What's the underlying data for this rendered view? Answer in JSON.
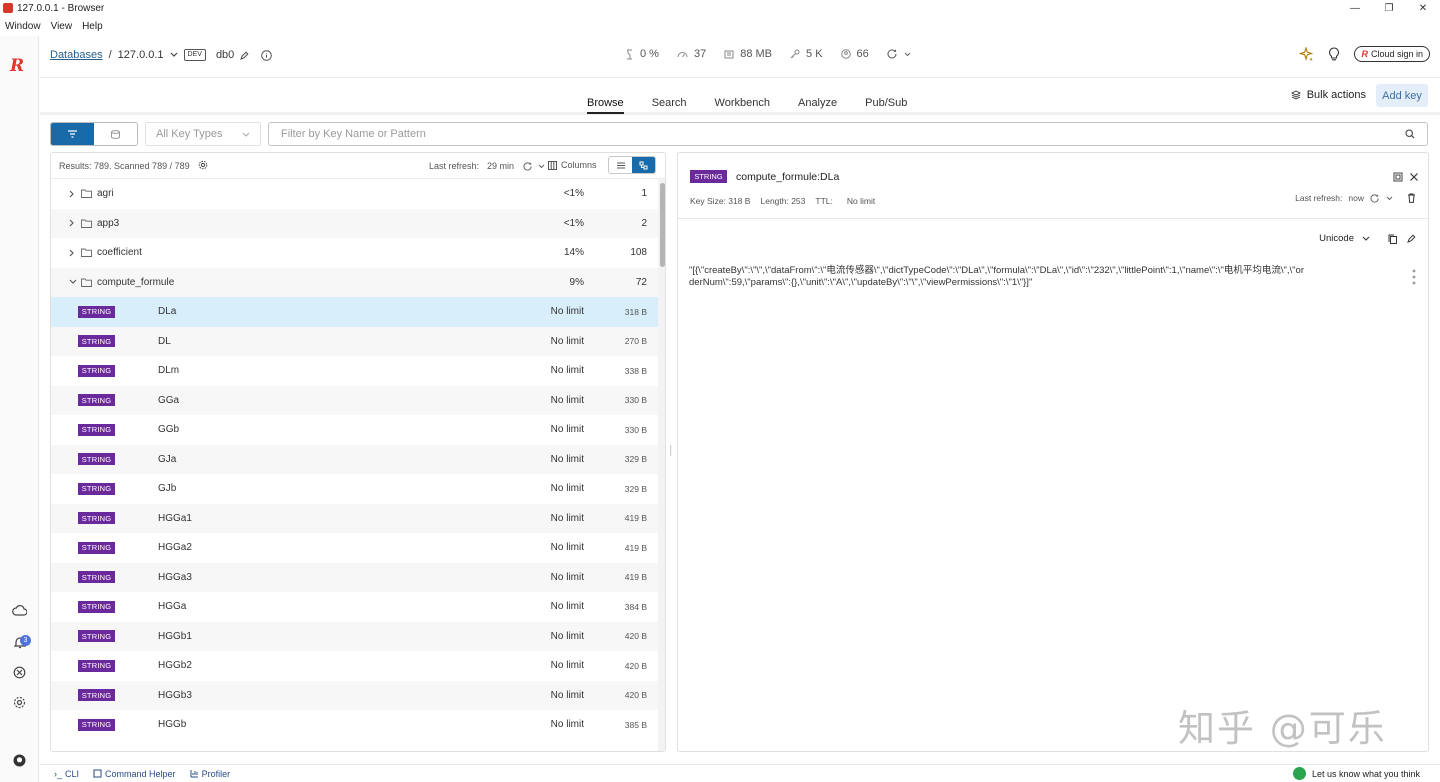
{
  "window": {
    "title": "127.0.0.1 - Browser",
    "menu": [
      "Window",
      "View",
      "Help"
    ]
  },
  "breadcrumb": {
    "databases": "Databases",
    "sep": "/",
    "host": "127.0.0.1",
    "env_badge": "DEV",
    "db": "db0"
  },
  "stats": {
    "cpu": "0 %",
    "ops": "37",
    "memory": "88 MB",
    "keys": "5 K",
    "clients": "66"
  },
  "header_right": {
    "cloud_signin": "Cloud sign in"
  },
  "tabs": [
    {
      "label": "Browse",
      "active": true
    },
    {
      "label": "Search",
      "active": false
    },
    {
      "label": "Workbench",
      "active": false
    },
    {
      "label": "Analyze",
      "active": false
    },
    {
      "label": "Pub/Sub",
      "active": false
    }
  ],
  "actions": {
    "bulk": "Bulk actions",
    "add_key": "Add key"
  },
  "filters": {
    "key_type_placeholder": "All Key Types",
    "search_placeholder": "Filter by Key Name or Pattern"
  },
  "list": {
    "results": "Results: 789. Scanned 789 / 789",
    "last_refresh_label": "Last refresh:",
    "last_refresh_value": "29 min",
    "columns_label": "Columns",
    "folders": [
      {
        "name": "agri",
        "pct": "<1%",
        "count": "1",
        "expanded": false
      },
      {
        "name": "app3",
        "pct": "<1%",
        "count": "2",
        "expanded": false
      },
      {
        "name": "coefficient",
        "pct": "14%",
        "count": "108",
        "expanded": false
      },
      {
        "name": "compute_formule",
        "pct": "9%",
        "count": "72",
        "expanded": true
      }
    ],
    "keys": [
      {
        "type": "STRING",
        "name": "DLa",
        "ttl": "No limit",
        "size": "318 B",
        "selected": true
      },
      {
        "type": "STRING",
        "name": "DL",
        "ttl": "No limit",
        "size": "270 B"
      },
      {
        "type": "STRING",
        "name": "DLm",
        "ttl": "No limit",
        "size": "338 B"
      },
      {
        "type": "STRING",
        "name": "GGa",
        "ttl": "No limit",
        "size": "330 B"
      },
      {
        "type": "STRING",
        "name": "GGb",
        "ttl": "No limit",
        "size": "330 B"
      },
      {
        "type": "STRING",
        "name": "GJa",
        "ttl": "No limit",
        "size": "329 B"
      },
      {
        "type": "STRING",
        "name": "GJb",
        "ttl": "No limit",
        "size": "329 B"
      },
      {
        "type": "STRING",
        "name": "HGGa1",
        "ttl": "No limit",
        "size": "419 B"
      },
      {
        "type": "STRING",
        "name": "HGGa2",
        "ttl": "No limit",
        "size": "419 B"
      },
      {
        "type": "STRING",
        "name": "HGGa3",
        "ttl": "No limit",
        "size": "419 B"
      },
      {
        "type": "STRING",
        "name": "HGGa",
        "ttl": "No limit",
        "size": "384 B"
      },
      {
        "type": "STRING",
        "name": "HGGb1",
        "ttl": "No limit",
        "size": "420 B"
      },
      {
        "type": "STRING",
        "name": "HGGb2",
        "ttl": "No limit",
        "size": "420 B"
      },
      {
        "type": "STRING",
        "name": "HGGb3",
        "ttl": "No limit",
        "size": "420 B"
      },
      {
        "type": "STRING",
        "name": "HGGb",
        "ttl": "No limit",
        "size": "385 B"
      }
    ]
  },
  "details": {
    "type": "STRING",
    "key": "compute_formule:DLa",
    "key_size": "Key Size: 318 B",
    "length": "Length: 253",
    "ttl_label": "TTL:",
    "ttl_value": "No limit",
    "last_refresh_label": "Last refresh:",
    "last_refresh_value": "now",
    "encoding": "Unicode",
    "value": "\"[{\\\"createBy\\\":\\\"\\\",\\\"dataFrom\\\":\\\"电流传感器\\\",\\\"dictTypeCode\\\":\\\"DLa\\\",\\\"formula\\\":\\\"DLa\\\",\\\"id\\\":\\\"232\\\",\\\"littlePoint\\\":1,\\\"name\\\":\\\"电机平均电流\\\",\\\"orderNum\\\":59,\\\"params\\\":{},\\\"unit\\\":\\\"A\\\",\\\"updateBy\\\":\\\"\\\",\\\"viewPermissions\\\":\\\"1\\\"}]\""
  },
  "watermark": "知乎 @可乐",
  "sidebar": {
    "notification_count": "3"
  },
  "bottom": {
    "cli": "CLI",
    "command_helper": "Command Helper",
    "profiler": "Profiler",
    "feedback": "Let us know what you think"
  },
  "colors": {
    "accent": "#186aa8",
    "string_badge": "#6b2a9c",
    "selected_row": "#d9eefb",
    "brand": "#dc382c"
  }
}
